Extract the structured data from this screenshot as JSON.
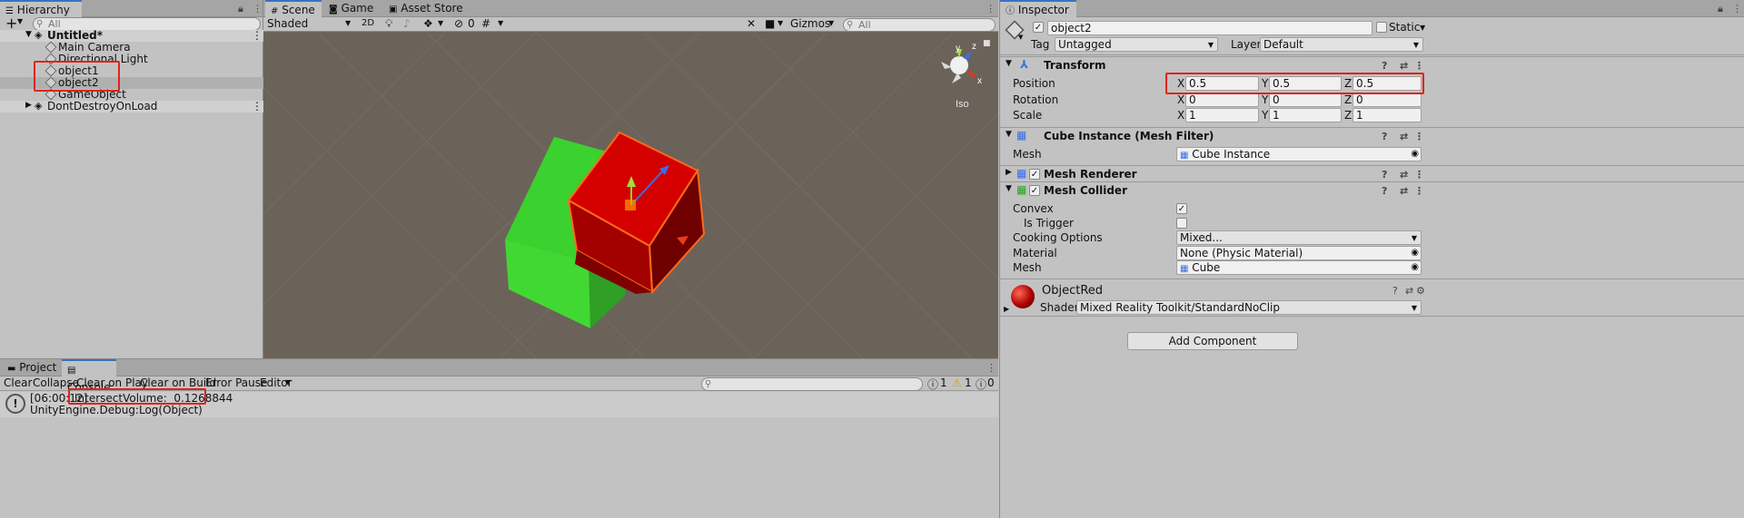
{
  "hierarchy": {
    "tab": "Hierarchy",
    "search_placeholder": "All",
    "add_label": "+",
    "scene_name": "Untitled*",
    "items": [
      "Main Camera",
      "Directional Light",
      "object1",
      "object2",
      "GameObject"
    ],
    "dont_destroy": "DontDestroyOnLoad"
  },
  "scene": {
    "tabs": [
      "Scene",
      "Game",
      "Asset Store"
    ],
    "shading": "Shaded",
    "mode_2d": "2D",
    "hidden_count": "0",
    "gizmos": "Gizmos",
    "search_placeholder": "All",
    "projection": "Iso",
    "axis_y": "y",
    "axis_z": "z",
    "axis_x": "x"
  },
  "console": {
    "tabs": [
      "Project",
      "Console"
    ],
    "buttons": [
      "Clear",
      "Collapse",
      "Clear on Play",
      "Clear on Build",
      "Error Pause",
      "Editor"
    ],
    "counts": {
      "info": "1",
      "warn": "1",
      "error": "0"
    },
    "log_time": "[06:00:12]",
    "log_message": "IntersectVolume:  0.1268844",
    "log_stack": "UnityEngine.Debug:Log(Object)"
  },
  "inspector": {
    "tab": "Inspector",
    "object_name": "object2",
    "static_label": "Static",
    "tag_label": "Tag",
    "tag_value": "Untagged",
    "layer_label": "Layer",
    "layer_value": "Default",
    "transform": {
      "title": "Transform",
      "position_label": "Position",
      "rotation_label": "Rotation",
      "scale_label": "Scale",
      "position": {
        "x": "0.5",
        "y": "0.5",
        "z": "0.5"
      },
      "rotation": {
        "x": "0",
        "y": "0",
        "z": "0"
      },
      "scale": {
        "x": "1",
        "y": "1",
        "z": "1"
      }
    },
    "mesh_filter": {
      "title": "Cube Instance (Mesh Filter)",
      "mesh_label": "Mesh",
      "mesh_value": "Cube Instance"
    },
    "mesh_renderer": {
      "title": "Mesh Renderer"
    },
    "mesh_collider": {
      "title": "Mesh Collider",
      "convex_label": "Convex",
      "is_trigger_label": "Is Trigger",
      "cooking_label": "Cooking Options",
      "cooking_value": "Mixed...",
      "material_label": "Material",
      "material_value": "None (Physic Material)",
      "mesh_label": "Mesh",
      "mesh_value": "Cube"
    },
    "material": {
      "name": "ObjectRed",
      "shader_label": "Shader",
      "shader_value": "Mixed Reality Toolkit/StandardNoClip"
    },
    "add_component": "Add Component"
  },
  "axis_letters": {
    "x": "X",
    "y": "Y",
    "z": "Z"
  },
  "colors": {
    "highlight": "#e0231d",
    "selection": "#3a72c0",
    "red_cube": "#d40000",
    "green_cube": "#3bd12e",
    "scene_bg": "#6b6359"
  }
}
